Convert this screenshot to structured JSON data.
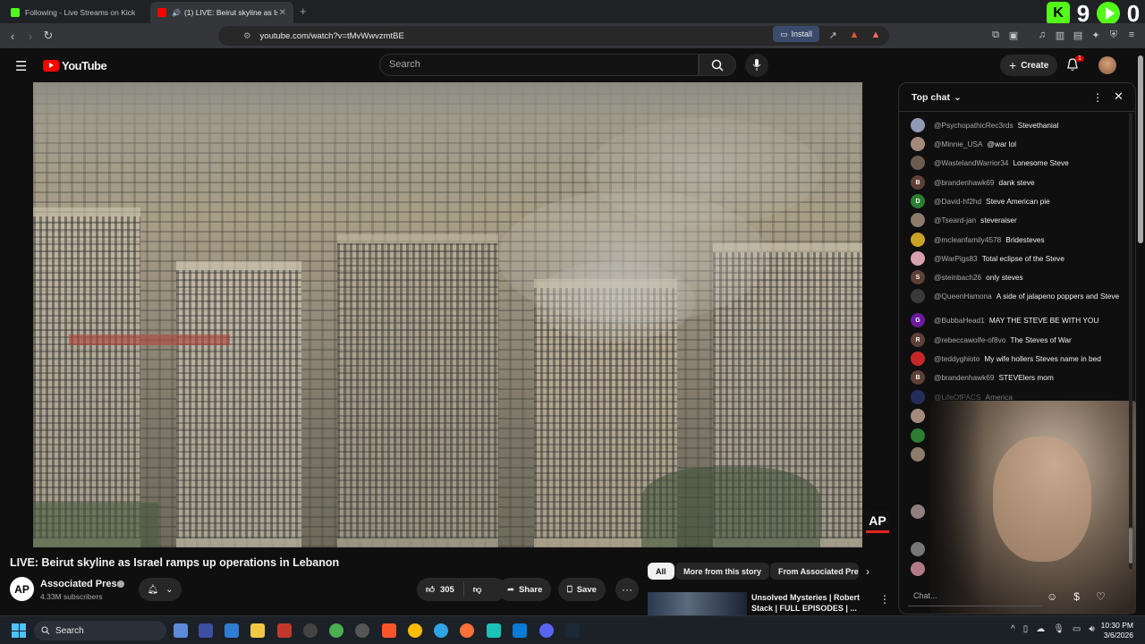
{
  "browser": {
    "tabs": [
      {
        "title": "Following - Live Streams on Kick",
        "favicon_color": "#53fc18",
        "active": false
      },
      {
        "title": "(1) LIVE: Beirut skyline as Isra",
        "favicon_color": "#ff0000",
        "active": true
      }
    ],
    "new_tab": "+",
    "url": "youtube.com/watch?v=tMvWwvzmtBE",
    "install_label": "Install",
    "overlay_counters": {
      "kick_count": "9",
      "other_count": "0"
    }
  },
  "youtube": {
    "logo_text": "YouTube",
    "search_placeholder": "Search",
    "create_label": "Create",
    "notification_count": "1"
  },
  "video": {
    "title": "LIVE: Beirut skyline as Israel ramps up operations in Lebanon",
    "watermark": "AP",
    "channel": {
      "avatar_text": "AP",
      "name": "Associated Press",
      "subscribers": "4.33M subscribers"
    },
    "like_count": "305",
    "share_label": "Share",
    "save_label": "Save"
  },
  "suggestions": {
    "chips": [
      "All",
      "More from this story",
      "From Associated Pre"
    ],
    "recommended": {
      "title": "Unsolved Mysteries | Robert Stack | FULL EPISODES | ..."
    }
  },
  "chat": {
    "header": "Top chat",
    "input_placeholder": "Chat...",
    "messages": [
      {
        "author": "@PsychopathicRec3rds",
        "text": "Stevethanial",
        "avatar_color": "#8f9bb5",
        "avatar_letter": ""
      },
      {
        "author": "@Minnie_USA",
        "text": "@war lol",
        "avatar_color": "#a58a7c",
        "avatar_letter": ""
      },
      {
        "author": "@WastelandWarrior34",
        "text": "Lonesome Steve",
        "avatar_color": "#6b5a4e",
        "avatar_letter": ""
      },
      {
        "author": "@brandenhawk69",
        "text": "dank steve",
        "avatar_color": "#5d4037",
        "avatar_letter": "B"
      },
      {
        "author": "@David-hf2hd",
        "text": "Steve American pie",
        "avatar_color": "#2e7d32",
        "avatar_letter": "D"
      },
      {
        "author": "@Tseard-jan",
        "text": "steveraiser",
        "avatar_color": "#8d7b6b",
        "avatar_letter": ""
      },
      {
        "author": "@mcleanfamily4578",
        "text": "Bridesteves",
        "avatar_color": "#c9a227",
        "avatar_letter": ""
      },
      {
        "author": "@WarPigs83",
        "text": "Total eclipse of the Steve",
        "avatar_color": "#d7a0b0",
        "avatar_letter": ""
      },
      {
        "author": "@steinbach26",
        "text": "only steves",
        "avatar_color": "#5d4037",
        "avatar_letter": "S"
      },
      {
        "author": "@QueenHamona",
        "text": "A side of jalapeno poppers and Steve",
        "avatar_color": "#3a3a3a",
        "avatar_letter": ""
      },
      {
        "author": "@BubbaHead1",
        "text": "MAY THE STEVE BE WITH YOU",
        "avatar_color": "#6a1b9a",
        "avatar_letter": "G"
      },
      {
        "author": "@rebeccawolfe-of8vo",
        "text": "The Steves of War",
        "avatar_color": "#5d4037",
        "avatar_letter": "R"
      },
      {
        "author": "@teddyghioto",
        "text": "My wife hollers Steves name in bed",
        "avatar_color": "#c62828",
        "avatar_letter": ""
      },
      {
        "author": "@brandenhawk69",
        "text": "STEVElers mom",
        "avatar_color": "#5d4037",
        "avatar_letter": "B"
      },
      {
        "author": "@LifeOfPACS",
        "text": "America",
        "avatar_color": "#3f51b5",
        "avatar_letter": ""
      }
    ]
  },
  "taskbar": {
    "search_placeholder": "Search",
    "time": "10:30 PM",
    "date": "3/6/2026"
  },
  "colors": {
    "background": "#0f0f0f",
    "accent_red": "#ff0000",
    "kick_green": "#53fc18"
  }
}
